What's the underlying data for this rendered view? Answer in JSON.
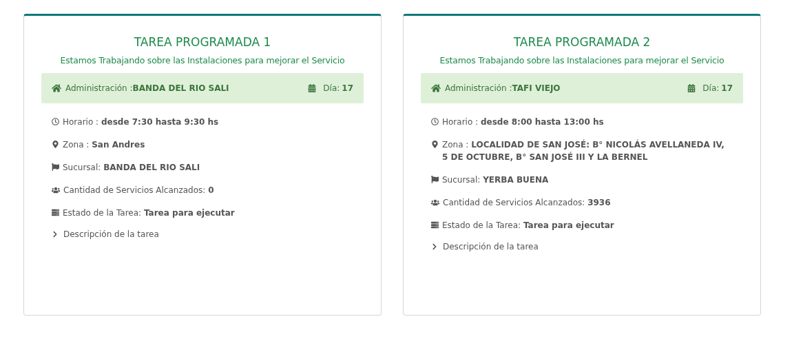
{
  "cards": [
    {
      "title": "TAREA PROGRAMADA 1",
      "subtitle": "Estamos Trabajando sobre las Instalaciones para mejorar el Servicio",
      "admin_label": "Administración :",
      "admin_value": "BANDA DEL RIO SALI",
      "day_label": "Día:",
      "day_value": "17",
      "fields": [
        {
          "kind": "clock",
          "label": "Horario :",
          "value": "desde 7:30 hasta 9:30 hs"
        },
        {
          "kind": "pin",
          "label": "Zona :",
          "value": "San Andres"
        },
        {
          "kind": "flag",
          "label": "Sucursal:",
          "value": "BANDA DEL RIO SALI"
        },
        {
          "kind": "users",
          "label": "Cantidad de Servicios Alcanzados:",
          "value": "0"
        },
        {
          "kind": "status",
          "label": "Estado de la Tarea:",
          "value": "Tarea para ejecutar"
        }
      ],
      "description": {
        "label": "Descripción de la tarea",
        "expanded": false
      }
    },
    {
      "title": "TAREA PROGRAMADA 2",
      "subtitle": "Estamos Trabajando sobre las Instalaciones para mejorar el Servicio",
      "admin_label": "Administración :",
      "admin_value": "TAFI VIEJO",
      "day_label": "Día:",
      "day_value": "17",
      "fields": [
        {
          "kind": "clock",
          "label": "Horario :",
          "value": "desde 8:00 hasta 13:00 hs"
        },
        {
          "kind": "pin",
          "label": "Zona :",
          "value": "LOCALIDAD DE SAN JOSÉ: B° NICOLÁS AVELLANEDA IV, 5 DE OCTUBRE, B° SAN JOSÉ III Y LA BERNEL"
        },
        {
          "kind": "flag",
          "label": "Sucursal:",
          "value": "YERBA BUENA"
        },
        {
          "kind": "users",
          "label": "Cantidad de Servicios Alcanzados:",
          "value": "3936"
        },
        {
          "kind": "status",
          "label": "Estado de la Tarea:",
          "value": "Tarea para ejecutar"
        }
      ],
      "description": {
        "label": "Descripción de la tarea",
        "expanded": false
      }
    }
  ]
}
